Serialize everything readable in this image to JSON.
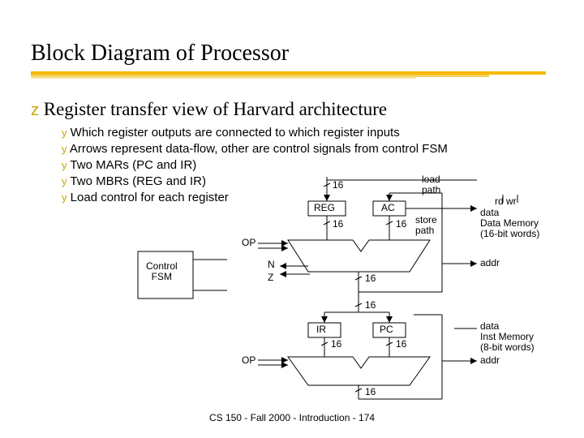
{
  "title": "Block Diagram of Processor",
  "footer": "CS 150 - Fall 2000 - Introduction - 174",
  "bullets": {
    "z1": "Register transfer view of Harvard architecture",
    "y1": "Which register outputs are connected to which register inputs",
    "y2": "Arrows represent data-flow, other are control signals from control FSM",
    "y3": "Two MARs (PC and IR)",
    "y4": "Two MBRs (REG and IR)",
    "y5": "Load control for each register"
  },
  "labels": {
    "ctrl_fsm": "Control\nFSM",
    "op1": "OP",
    "op2": "OP",
    "n": "N",
    "z": "Z",
    "reg": "REG",
    "ac": "AC",
    "ir": "IR",
    "pc": "PC",
    "load_path": "load\npath",
    "store_path": "store\npath",
    "rd_wr": "rd  wr",
    "data_mem": "data\nData Memory\n(16-bit words)",
    "addr1": "addr",
    "inst_mem": "data\nInst Memory\n(8-bit words)",
    "addr2": "addr",
    "w16a": "16",
    "w16b": "16",
    "w16c": "16",
    "w16d": "16",
    "w16e": "16",
    "w16f": "16",
    "w16g": "16",
    "w16h": "16"
  }
}
